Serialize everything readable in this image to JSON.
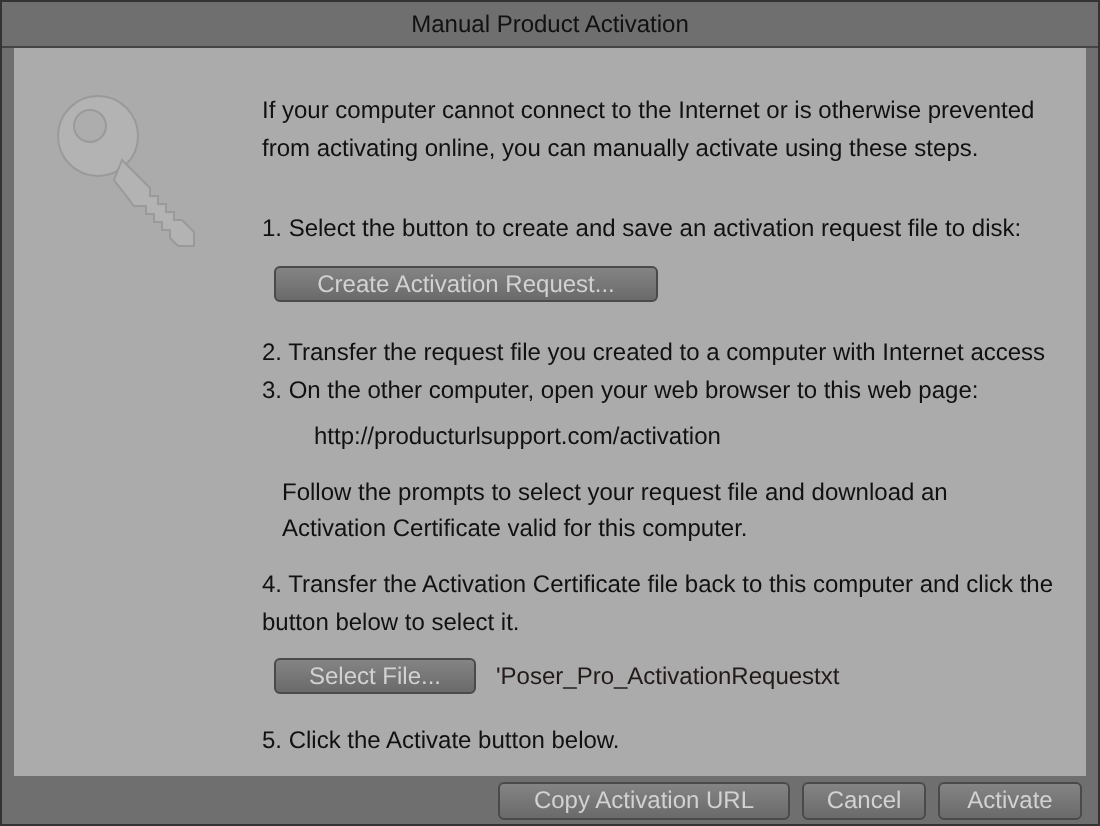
{
  "window": {
    "title": "Manual Product Activation"
  },
  "intro": "If your computer cannot connect to the Internet or is otherwise prevented from activating online, you can manually activate using these steps.",
  "steps": [
    {
      "kind": "text",
      "text": "1. Select the button to create and save an activation request file to disk:"
    },
    {
      "kind": "button",
      "label": "Create Activation Request..."
    },
    {
      "kind": "text",
      "text": "2. Transfer the request file you created to a computer with Internet access"
    },
    {
      "kind": "text",
      "text": "3. On the other computer, open your web browser to this web page:"
    },
    {
      "kind": "url",
      "text": "http://producturlsupport.com/activation"
    },
    {
      "kind": "note",
      "text": "Follow the prompts to select your request file and download an Activation Certificate valid for this computer."
    },
    {
      "kind": "text",
      "text": "4. Transfer the Activation Certificate file back to this computer and click the button below to select it."
    },
    {
      "kind": "file",
      "label": "Select File...",
      "value": "'Poser_Pro_ActivationRequestxt"
    },
    {
      "kind": "text",
      "text": "5. Click the Activate button below."
    }
  ],
  "buttons": [
    "Copy Activation URL",
    "Cancel",
    "Activate"
  ]
}
